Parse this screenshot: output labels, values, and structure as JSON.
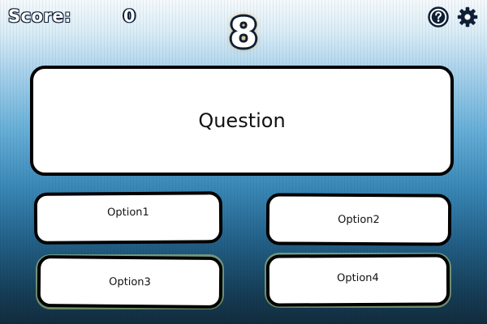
{
  "hud": {
    "score_label": "Score:",
    "score_value": "0",
    "timer": "8",
    "help_icon": "help-circle-icon",
    "settings_icon": "gear-icon"
  },
  "question": {
    "text": "Question"
  },
  "options": [
    {
      "label": "Option1"
    },
    {
      "label": "Option2"
    },
    {
      "label": "Option3"
    },
    {
      "label": "Option4"
    }
  ],
  "colors": {
    "card_fill": "#ffffff",
    "card_border": "#000000",
    "hud_outline": "#0e1e35",
    "timer_glow": "#e8a545",
    "background_top": "#f4f9fc",
    "background_bottom": "#122c3d"
  }
}
